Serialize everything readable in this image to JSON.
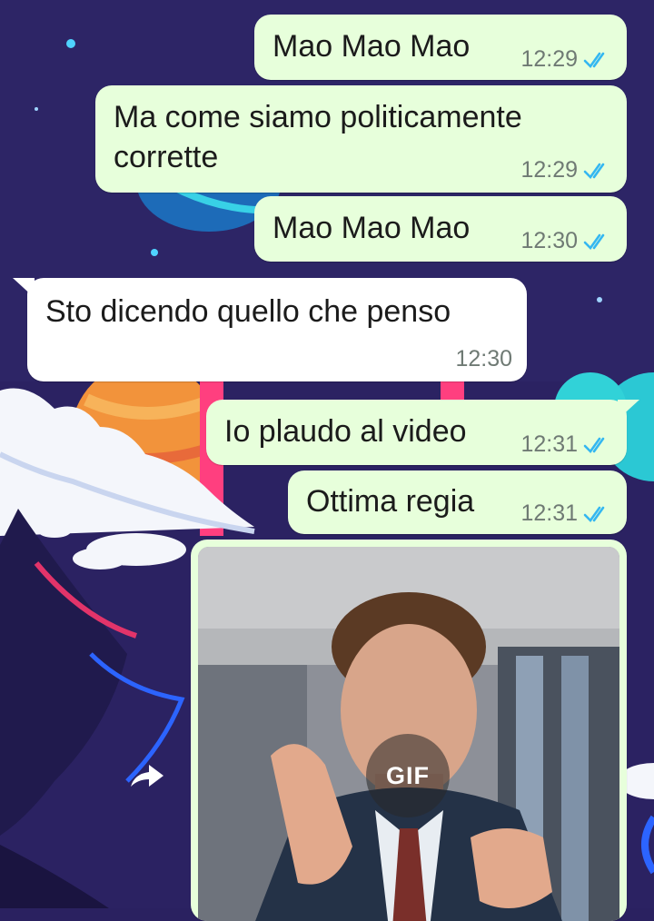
{
  "messages": [
    {
      "id": "m1",
      "direction": "outgoing",
      "text": "Mao Mao Mao",
      "time": "12:29",
      "status": "read"
    },
    {
      "id": "m2",
      "direction": "outgoing",
      "text_lines": [
        "Ma come siamo politicamente",
        "corrette"
      ],
      "time": "12:29",
      "status": "read"
    },
    {
      "id": "m3",
      "direction": "outgoing",
      "text": "Mao Mao Mao",
      "time": "12:30",
      "status": "read"
    },
    {
      "id": "m4",
      "direction": "incoming",
      "text": "Sto dicendo quello che penso",
      "time": "12:30"
    },
    {
      "id": "m5",
      "direction": "outgoing",
      "text": "Io plaudo al video",
      "time": "12:31",
      "status": "read"
    },
    {
      "id": "m6",
      "direction": "outgoing",
      "text": "Ottima regia",
      "time": "12:31",
      "status": "read"
    }
  ],
  "gif": {
    "badge_label": "GIF",
    "icon": "gif-badge"
  },
  "forward": {
    "icon": "forward-arrow-icon"
  },
  "colors": {
    "outgoing_bubble": "#e7ffdb",
    "incoming_bubble": "#ffffff",
    "read_ticks": "#34b7f1",
    "wallpaper_bg": "#2a2160"
  }
}
